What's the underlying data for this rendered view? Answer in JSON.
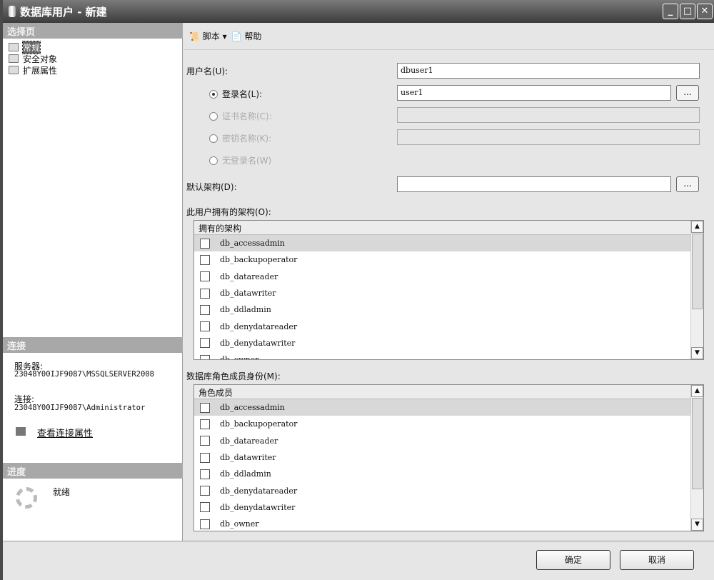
{
  "window": {
    "title": "数据库用户 - 新建"
  },
  "left": {
    "select_page_header": "选择页",
    "pages": [
      "常规",
      "安全对象",
      "扩展属性"
    ],
    "connection_header": "连接",
    "server_label": "服务器:",
    "server_value": "23048Y00IJF9087\\MSSQLSERVER2008",
    "connection_label": "连接:",
    "connection_value": "23048Y00IJF9087\\Administrator",
    "view_props_link": "查看连接属性",
    "progress_header": "进度",
    "progress_status": "就绪"
  },
  "toolbar": {
    "script": "脚本",
    "help": "帮助"
  },
  "form": {
    "username_label": "用户名(U):",
    "username_value": "dbuser1",
    "login_label": "登录名(L):",
    "login_value": "user1",
    "cert_label": "证书名称(C):",
    "key_label": "密钥名称(K):",
    "nologin_label": "无登录名(W)",
    "schema_label": "默认架构(D):",
    "schema_value": "",
    "browse": "..."
  },
  "owned_schemas": {
    "label": "此用户拥有的架构(O):",
    "header": "拥有的架构",
    "items": [
      "db_accessadmin",
      "db_backupoperator",
      "db_datareader",
      "db_datawriter",
      "db_ddladmin",
      "db_denydatareader",
      "db_denydatawriter",
      "db_owner"
    ]
  },
  "role_membership": {
    "label": "数据库角色成员身份(M):",
    "header": "角色成员",
    "items": [
      "db_accessadmin",
      "db_backupoperator",
      "db_datareader",
      "db_datawriter",
      "db_ddladmin",
      "db_denydatareader",
      "db_denydatawriter",
      "db_owner"
    ]
  },
  "footer": {
    "ok": "确定",
    "cancel": "取消"
  }
}
